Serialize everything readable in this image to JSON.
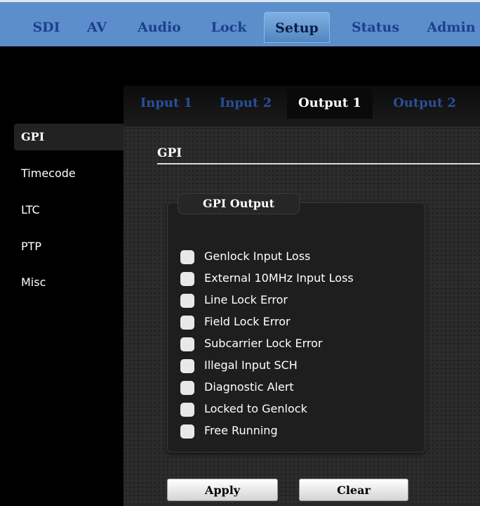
{
  "topnav": {
    "tabs": [
      {
        "label": "SDI"
      },
      {
        "label": "AV"
      },
      {
        "label": "Audio"
      },
      {
        "label": "Lock"
      },
      {
        "label": "Setup"
      },
      {
        "label": "Status"
      },
      {
        "label": "Admin"
      }
    ],
    "active": "Setup"
  },
  "sidebar": {
    "items": [
      {
        "label": "GPI"
      },
      {
        "label": "Timecode"
      },
      {
        "label": "LTC"
      },
      {
        "label": "PTP"
      },
      {
        "label": "Misc"
      }
    ],
    "active": "GPI"
  },
  "subtabs": {
    "items": [
      {
        "label": "Input 1"
      },
      {
        "label": "Input 2"
      },
      {
        "label": "Output 1"
      },
      {
        "label": "Output 2"
      }
    ],
    "active": "Output 1"
  },
  "main": {
    "section_title": "GPI",
    "group_title": "GPI Output",
    "options": [
      {
        "label": "Genlock Input Loss",
        "checked": false
      },
      {
        "label": "External 10MHz Input Loss",
        "checked": false
      },
      {
        "label": "Line Lock Error",
        "checked": false
      },
      {
        "label": "Field Lock Error",
        "checked": false
      },
      {
        "label": "Subcarrier Lock Error",
        "checked": false
      },
      {
        "label": "Illegal Input SCH",
        "checked": false
      },
      {
        "label": "Diagnostic Alert",
        "checked": false
      },
      {
        "label": "Locked to Genlock",
        "checked": false
      },
      {
        "label": "Free Running",
        "checked": false
      }
    ],
    "apply_label": "Apply",
    "clear_label": "Clear"
  },
  "colors": {
    "nav_bar": "#5b8ecb",
    "nav_text": "#1d3f8d",
    "subtab_text": "#2a4f9a",
    "panel": "#2c2c2c"
  }
}
